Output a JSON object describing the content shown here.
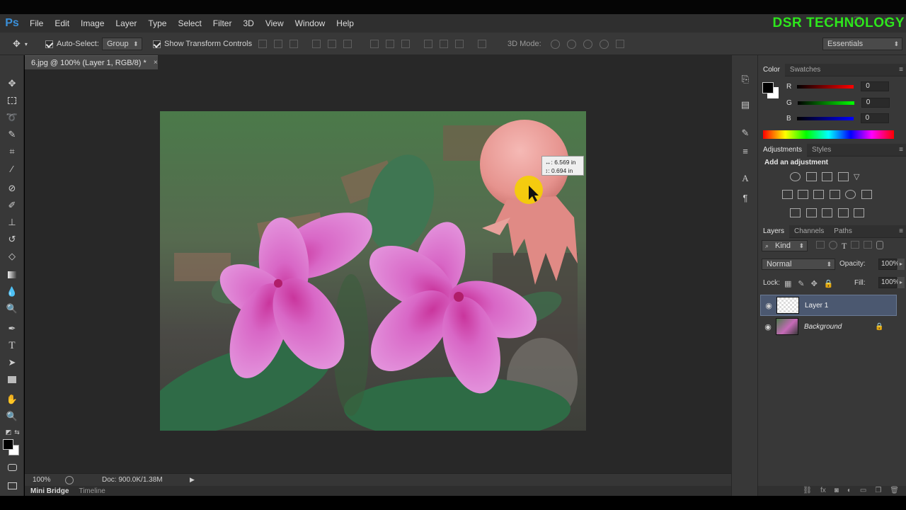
{
  "app": {
    "logo": "Ps",
    "brand_watermark": "DSR TECHNOLOGY"
  },
  "menu": [
    "File",
    "Edit",
    "Image",
    "Layer",
    "Type",
    "Select",
    "Filter",
    "3D",
    "View",
    "Window",
    "Help"
  ],
  "options_bar": {
    "auto_select_label": "Auto-Select:",
    "auto_select_value": "Group",
    "show_transform_label": "Show Transform Controls",
    "mode_3d_label": "3D Mode:",
    "workspace": "Essentials"
  },
  "document": {
    "tab_title": "6.jpg @ 100% (Layer 1, RGB/8) *",
    "tab_close": "×",
    "measure_x": "↔: 6.569 in",
    "measure_y": "↕: 0.694 in"
  },
  "status": {
    "zoom": "100%",
    "doc_size": "Doc: 900.0K/1.38M"
  },
  "bottom_tabs": [
    "Mini Bridge",
    "Timeline"
  ],
  "color_panel": {
    "tabs": [
      "Color",
      "Swatches"
    ],
    "sliders": [
      {
        "label": "R",
        "value": "0",
        "gradient": "#ff0000"
      },
      {
        "label": "G",
        "value": "0",
        "gradient": "#00ff00"
      },
      {
        "label": "B",
        "value": "0",
        "gradient": "#0000ff"
      }
    ]
  },
  "adjustments_panel": {
    "tabs": [
      "Adjustments",
      "Styles"
    ],
    "heading": "Add an adjustment"
  },
  "layers_panel": {
    "tabs": [
      "Layers",
      "Channels",
      "Paths"
    ],
    "filter_kind": "Kind",
    "blend_mode": "Normal",
    "opacity_label": "Opacity:",
    "opacity_value": "100%",
    "lock_label": "Lock:",
    "fill_label": "Fill:",
    "fill_value": "100%",
    "layers": [
      {
        "name": "Layer 1",
        "selected": true
      },
      {
        "name": "Background",
        "selected": false,
        "locked": true
      }
    ]
  },
  "colors": {
    "ps_blue": "#3a8fd8",
    "brand_green": "#2ee61c",
    "selected_layer": "#4b5870",
    "panel_bg": "#383838"
  }
}
